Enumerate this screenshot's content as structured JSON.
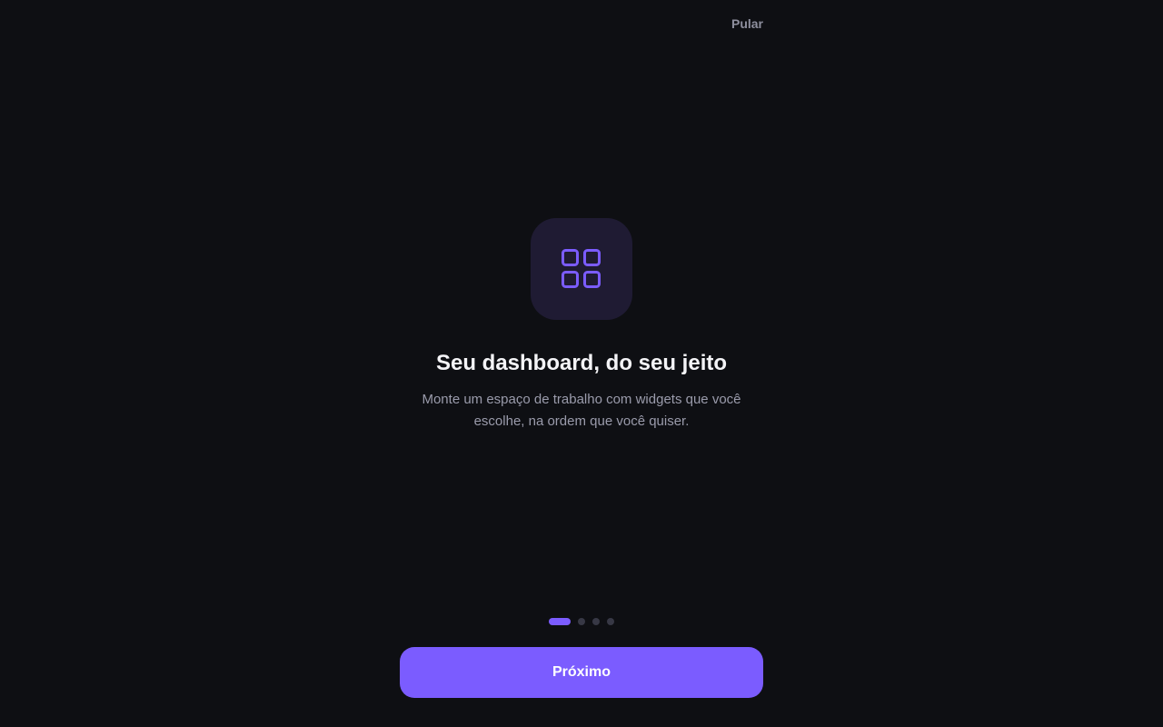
{
  "header": {
    "skip_label": "Pular"
  },
  "slide": {
    "icon": "grid-icon",
    "title": "Seu dashboard, do seu jeito",
    "description": "Monte um espaço de trabalho com widgets que você escolhe, na ordem que você quiser."
  },
  "pager": {
    "total": 4,
    "current": 1
  },
  "footer": {
    "next_label": "Próximo"
  },
  "colors": {
    "background": "#0e0f13",
    "accent": "#7b5cff",
    "icon_tile": "#1f1b33",
    "inactive_dot": "#373845",
    "muted_text": "#9a9bab"
  }
}
